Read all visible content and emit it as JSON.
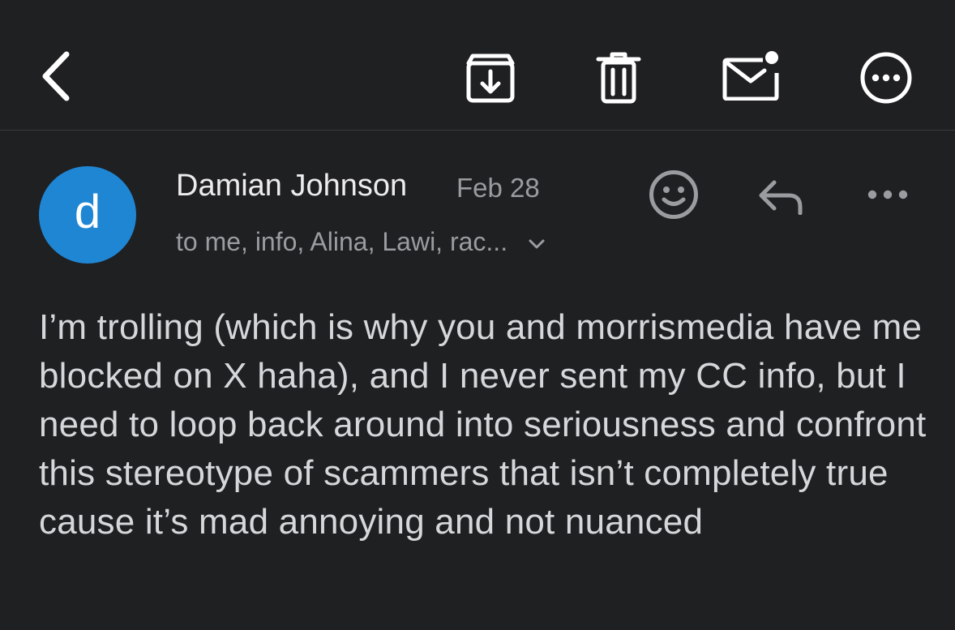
{
  "toolbar": {
    "icons": [
      "back-chevron-icon",
      "archive-icon",
      "trash-icon",
      "mark-unread-icon",
      "more-circle-icon"
    ]
  },
  "message": {
    "avatar_letter": "d",
    "avatar_color": "#1f86d4",
    "sender": "Damian Johnson",
    "date": "Feb 28",
    "recipients": "to me, info, Alina, Lawi, rac...",
    "body": "I’m trolling (which is why you and morrismedia have me blocked on X haha), and I never sent my CC info, but I need to loop back around into seriousness and confront this stereotype of scammers that isn’t completely true cause it’s mad annoying and not nuanced"
  },
  "colors": {
    "background": "#1f2022",
    "icon": "#ffffff",
    "secondary_text": "#9b9ca0"
  }
}
